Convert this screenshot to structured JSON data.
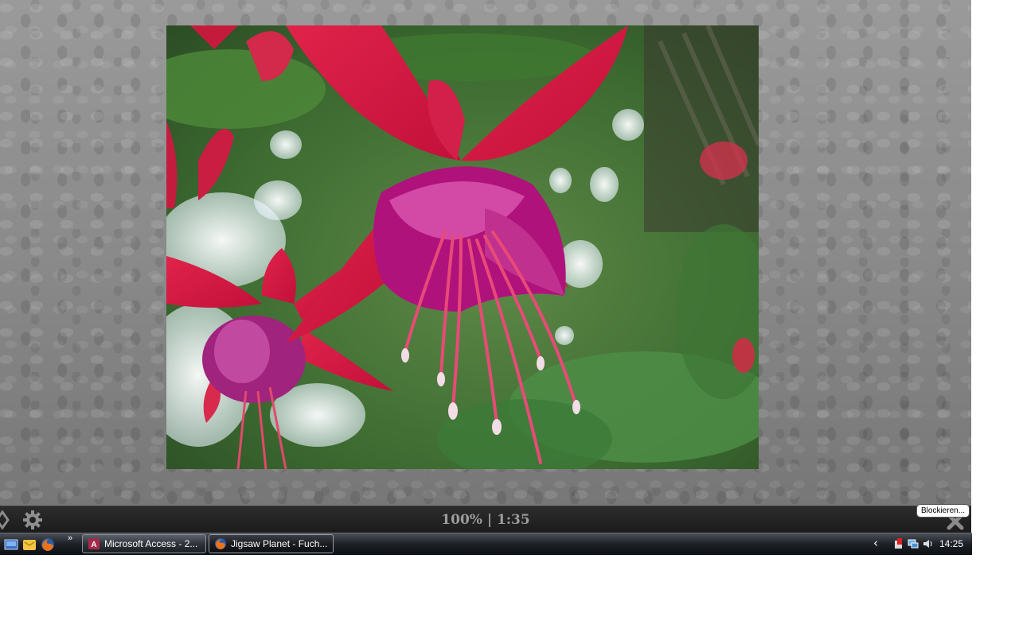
{
  "puzzle": {
    "image_subject": "fuchsia flower photo",
    "status": "100% | 1:35",
    "controls": {
      "left_icon": "move-icon",
      "settings_icon": "gear-icon",
      "close_icon": "close-icon"
    },
    "tooltip": "Blockieren..."
  },
  "taskbar": {
    "quick_launch": [
      "show-desktop-icon",
      "outlook-icon",
      "firefox-icon"
    ],
    "overflow": "»",
    "tasks": [
      {
        "label": "Microsoft Access - 2...",
        "icon": "access-icon",
        "active": false
      },
      {
        "label": "Jigsaw Planet - Fuch...",
        "icon": "firefox-icon",
        "active": true
      }
    ],
    "tray": {
      "expand": "‹",
      "icons": [
        "security-icon",
        "network-icon",
        "volume-icon"
      ],
      "clock": "14:25"
    }
  },
  "colors": {
    "puzzle_bg": "#8e8e8e",
    "control_bar": "#1f1f1f",
    "taskbar": "#1f2329"
  }
}
